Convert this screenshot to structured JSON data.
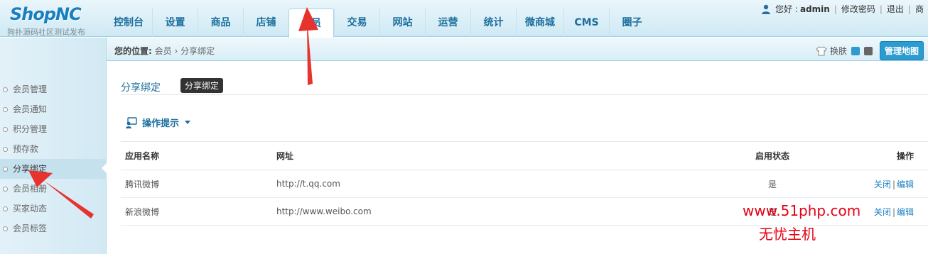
{
  "logo": {
    "name": "ShopNC",
    "subtitle": "狗扑源码社区测试发布"
  },
  "nav": {
    "tabs": [
      "控制台",
      "设置",
      "商品",
      "店铺",
      "会员",
      "交易",
      "网站",
      "运营",
      "统计",
      "微商城",
      "CMS",
      "圈子"
    ],
    "active": "会员"
  },
  "topbar": {
    "greeting": "您好 :",
    "username": "admin",
    "change_password": "修改密码",
    "logout": "退出",
    "trailing": "商"
  },
  "breadcrumb": {
    "label": "您的位置:",
    "section": "会员",
    "separator": "›",
    "page": "分享绑定"
  },
  "skin": {
    "label": "换肤",
    "colors": [
      "#2b9bd0",
      "#666666"
    ]
  },
  "map_button": "管理地图",
  "sidebar": {
    "items": [
      "会员管理",
      "会员通知",
      "积分管理",
      "预存款",
      "分享绑定",
      "会员相册",
      "买家动态",
      "会员标签"
    ],
    "active": "分享绑定"
  },
  "main": {
    "title": "分享绑定",
    "badge": "分享绑定",
    "tips_label": "操作提示",
    "table": {
      "headers": [
        "应用名称",
        "网址",
        "启用状态",
        "操作"
      ],
      "rows": [
        {
          "name": "腾讯微博",
          "url": "http://t.qq.com",
          "status": "是",
          "action_close": "关闭",
          "action_edit": "编辑"
        },
        {
          "name": "新浪微博",
          "url": "http://www.weibo.com",
          "status": "是",
          "action_close": "关闭",
          "action_edit": "编辑"
        }
      ],
      "separator": "|"
    }
  },
  "watermark": {
    "line1": "www.51php.com",
    "line2": "无忧主机"
  },
  "colors": {
    "accent": "#1c6f9d",
    "link": "#1a7fc0",
    "annotation": "#e8322d"
  }
}
